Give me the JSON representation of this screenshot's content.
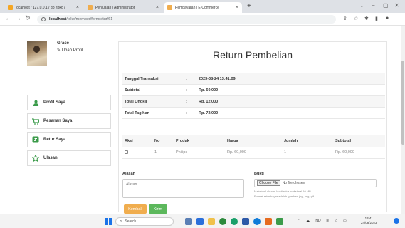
{
  "browser": {
    "tabs": [
      {
        "title": "localhost / 127.0.0.1 / db_toko / "
      },
      {
        "title": "Penjualan | Administrator"
      },
      {
        "title": "Pembayaran | E-Commerce"
      }
    ],
    "new_tab_symbol": "+",
    "url_host": "localhost",
    "url_path": "/toko/member/formretur/61"
  },
  "profile": {
    "name": "Grace",
    "edit_label": "Ubah Profil"
  },
  "sidebar": {
    "items": [
      {
        "label": "Profil Saya",
        "icon": "user-icon"
      },
      {
        "label": "Pesanan Saya",
        "icon": "cart-icon"
      },
      {
        "label": "Retur Saya",
        "icon": "return-icon"
      },
      {
        "label": "Ulasan",
        "icon": "star-icon"
      }
    ]
  },
  "main": {
    "title": "Return Pembelian",
    "info": [
      {
        "key": "Tanggal Transaksi",
        "sep": ":",
        "value": "2023-08-24 13:41:09"
      },
      {
        "key": "Subtotal",
        "sep": ":",
        "value": "Rp. 60,000"
      },
      {
        "key": "Total Ongkir",
        "sep": ":",
        "value": "Rp. 12,000"
      },
      {
        "key": "Total Tagihan",
        "sep": ":",
        "value": "Rp. 72,000"
      }
    ],
    "table": {
      "headers": [
        "Aksi",
        "No",
        "Produk",
        "Harga",
        "Jumlah",
        "Subtotal"
      ],
      "rows": [
        {
          "no": "1",
          "produk": "Philips",
          "harga": "Rp. 60,000",
          "jumlah": "1",
          "subtotal": "Rp. 60,000"
        }
      ]
    },
    "form": {
      "alasan_label": "Alasan",
      "alasan_placeholder": "Alasan",
      "bukti_label": "Bukti",
      "choose_file": "Choose File",
      "no_file": "No file chosen",
      "note1": "Maksimal ukuran bukti retur maksimal 10 MB",
      "note2": "Format retur bayar adalah gambar .jpg, png, gif",
      "back_label": "Kembali",
      "submit_label": "Kirim"
    }
  },
  "taskbar": {
    "search_placeholder": "Search",
    "lang": "IND",
    "time": "13:41",
    "date": "24/08/2023"
  },
  "colors": {
    "accent_green": "#5cb85c",
    "accent_orange": "#f0ad4e"
  }
}
